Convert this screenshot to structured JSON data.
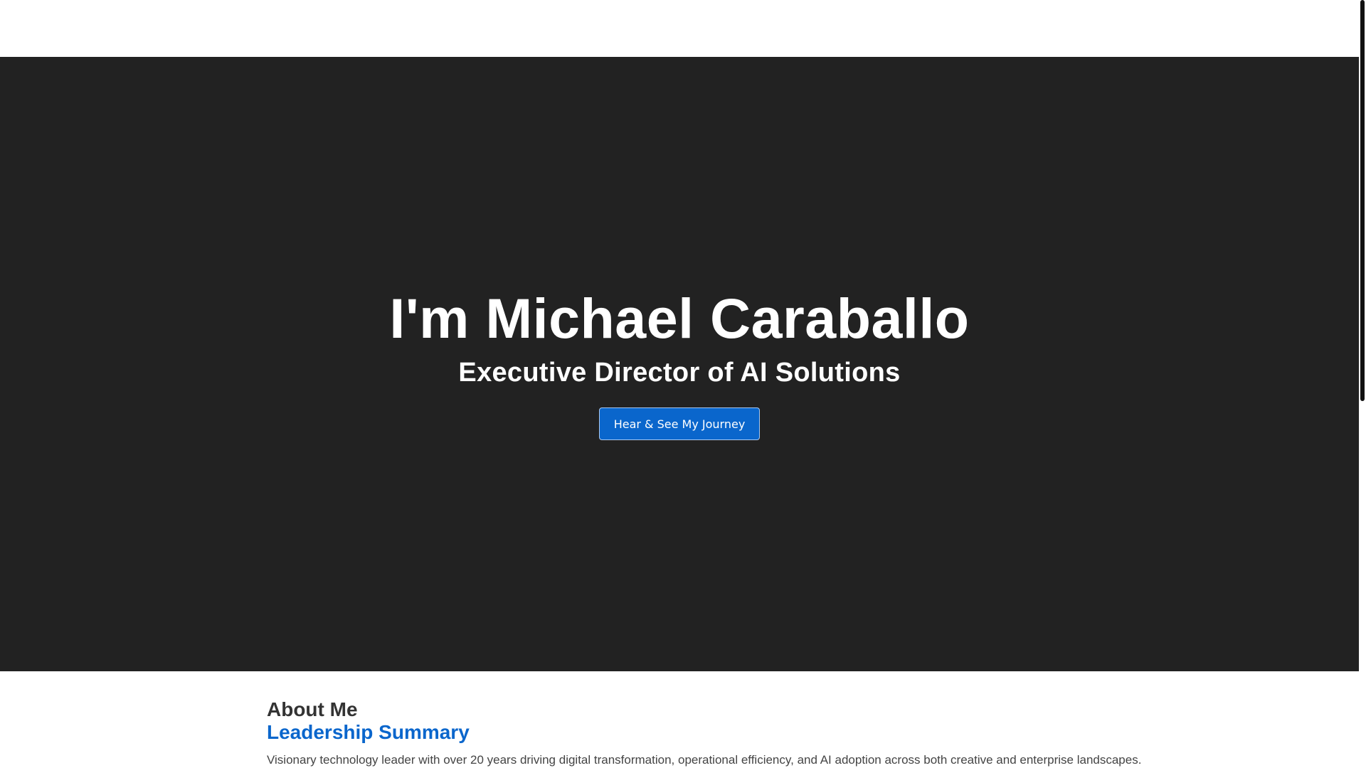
{
  "hero": {
    "title": "I'm Michael Caraballo",
    "subtitle": "Executive Director of AI Solutions",
    "cta_label": "Hear & See My Journey"
  },
  "about": {
    "heading": "About Me",
    "subheading": "Leadership Summary",
    "summary": "Visionary technology leader with over 20 years driving digital transformation, operational efficiency, and AI adoption across both creative and enterprise landscapes."
  },
  "colors": {
    "hero_background": "#222222",
    "accent": "#0a66cc",
    "heading_text": "#333333"
  }
}
